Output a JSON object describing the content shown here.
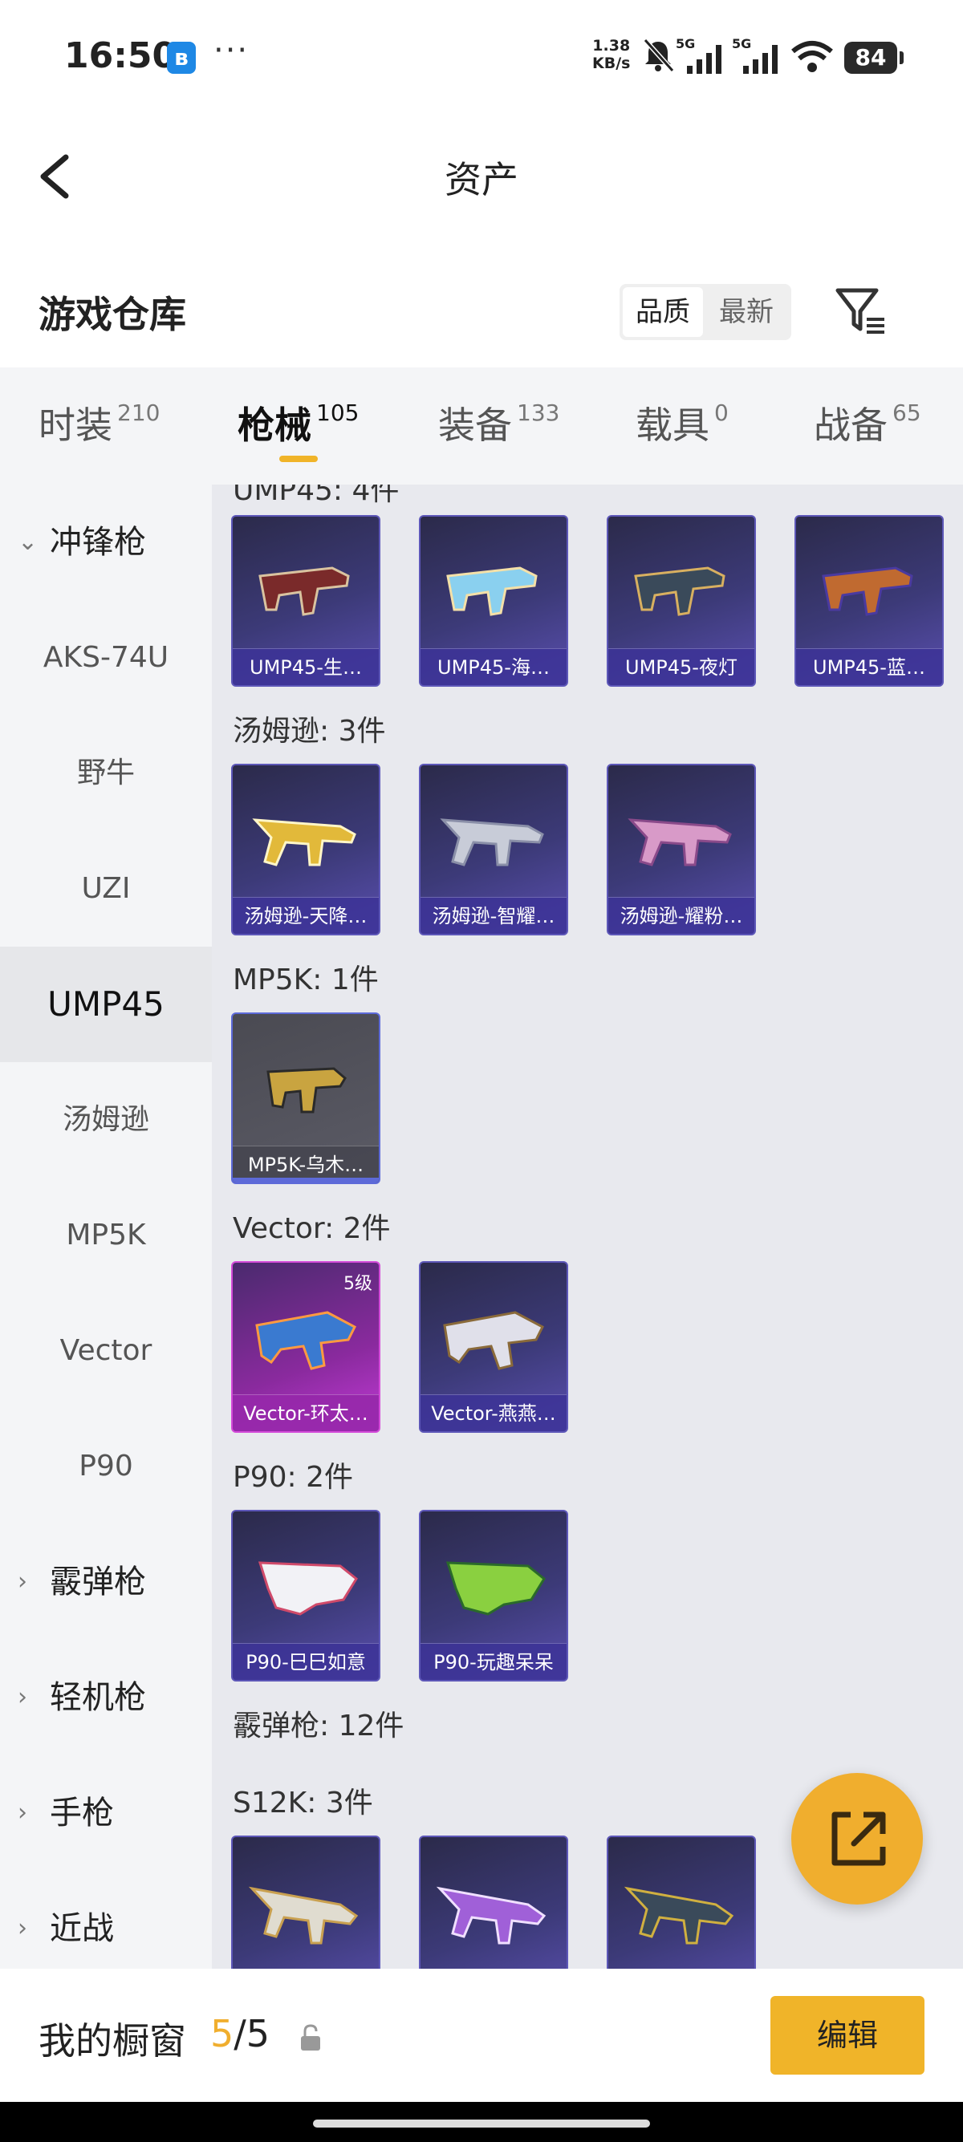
{
  "status_bar": {
    "time": "16:50",
    "bt_glyph": "ʙ",
    "dots": "···",
    "net_speed_value": "1.38",
    "net_speed_unit": "KB/s",
    "battery": "84"
  },
  "header": {
    "title": "资产"
  },
  "section": {
    "title": "游戏仓库",
    "sort_options": [
      "品质",
      "最新"
    ]
  },
  "tabs": [
    {
      "label": "时装",
      "count": "210"
    },
    {
      "label": "枪械",
      "count": "105"
    },
    {
      "label": "装备",
      "count": "133"
    },
    {
      "label": "载具",
      "count": "0"
    },
    {
      "label": "战备",
      "count": "65"
    }
  ],
  "sidebar": {
    "items": [
      {
        "label": "冲锋枪",
        "chev": "⌄"
      },
      {
        "label": "AKS-74U"
      },
      {
        "label": "野牛"
      },
      {
        "label": "UZI"
      },
      {
        "label": "UMP45"
      },
      {
        "label": "汤姆逊"
      },
      {
        "label": "MP5K"
      },
      {
        "label": "Vector"
      },
      {
        "label": "P90"
      },
      {
        "label": "霰弹枪",
        "chev": "›"
      },
      {
        "label": "轻机枪",
        "chev": "›"
      },
      {
        "label": "手枪",
        "chev": "›"
      },
      {
        "label": "近战",
        "chev": "›"
      }
    ]
  },
  "content": {
    "partial_label": "UMP45: 4件",
    "groups": [
      {
        "label": "汤姆逊: 3件"
      },
      {
        "label": "MP5K: 1件"
      },
      {
        "label": "Vector: 2件"
      },
      {
        "label": "P90: 2件"
      },
      {
        "label": "霰弹枪: 12件"
      },
      {
        "label": "S12K: 3件"
      }
    ],
    "cards": [
      {
        "name": "UMP45-生…"
      },
      {
        "name": "UMP45-海…"
      },
      {
        "name": "UMP45-夜灯"
      },
      {
        "name": "UMP45-蓝…"
      },
      {
        "name": "汤姆逊-天降…"
      },
      {
        "name": "汤姆逊-智耀…"
      },
      {
        "name": "汤姆逊-耀粉…"
      },
      {
        "name": "MP5K-乌木…"
      },
      {
        "name": "Vector-环太…",
        "level": "5级"
      },
      {
        "name": "Vector-燕燕…"
      },
      {
        "name": "P90-巳巳如意"
      },
      {
        "name": "P90-玩趣呆呆"
      },
      {
        "name": ""
      },
      {
        "name": ""
      },
      {
        "name": ""
      }
    ]
  },
  "bottom_bar": {
    "label": "我的橱窗",
    "current": "5",
    "total": "/5",
    "edit_label": "编辑"
  },
  "colors": {
    "accent": "#f0b429",
    "card_blue": "#3c3a78",
    "card_purple": "#c13bd6",
    "card_gray": "#5b5b66"
  }
}
